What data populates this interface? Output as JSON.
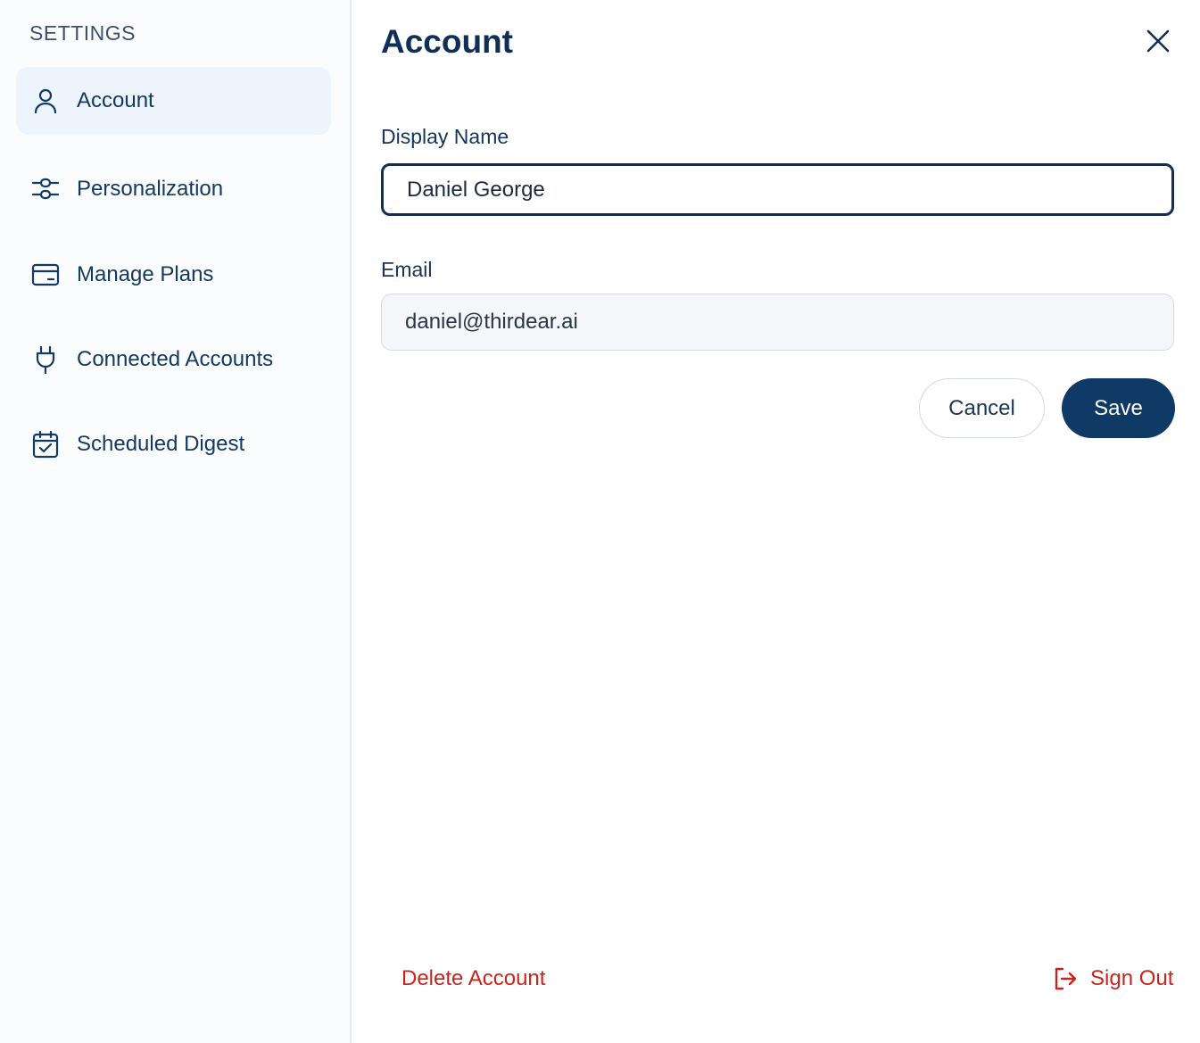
{
  "sidebar": {
    "heading": "SETTINGS",
    "items": [
      {
        "label": "Account",
        "icon": "user-icon",
        "active": true
      },
      {
        "label": "Personalization",
        "icon": "sliders-icon",
        "active": false
      },
      {
        "label": "Manage Plans",
        "icon": "credit-card-icon",
        "active": false
      },
      {
        "label": "Connected Accounts",
        "icon": "plug-icon",
        "active": false
      },
      {
        "label": "Scheduled Digest",
        "icon": "calendar-check-icon",
        "active": false
      }
    ]
  },
  "main": {
    "title": "Account",
    "close_icon": "close-icon",
    "display_name": {
      "label": "Display Name",
      "value": "Daniel George"
    },
    "email": {
      "label": "Email",
      "value": "daniel@thirdear.ai"
    },
    "cancel_label": "Cancel",
    "save_label": "Save",
    "delete_label": "Delete Account",
    "signout_label": "Sign Out",
    "signout_icon": "sign-out-icon"
  },
  "colors": {
    "primary": "#0f3a66",
    "accent_bg": "#edf4fc",
    "danger": "#c8251c",
    "text_dark": "#123a63"
  }
}
